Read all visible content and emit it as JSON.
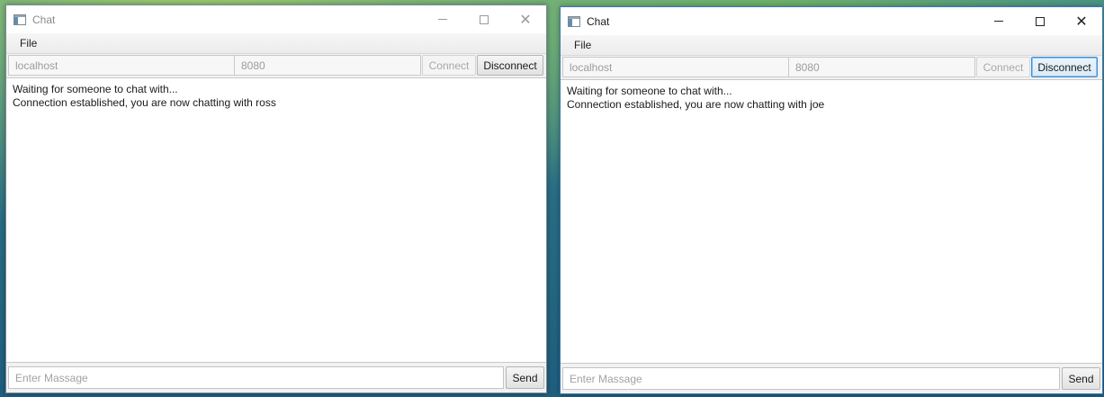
{
  "windows": [
    {
      "title": "Chat",
      "active": false,
      "menu": [
        "File"
      ],
      "host": "localhost",
      "port": "8080",
      "connect_label": "Connect",
      "disconnect_label": "Disconnect",
      "messages": [
        "Waiting for someone to chat with...",
        "Connection established, you are now chatting with ross"
      ],
      "message_placeholder": "Enter Massage",
      "send_label": "Send"
    },
    {
      "title": "Chat",
      "active": true,
      "menu": [
        "File"
      ],
      "host": "localhost",
      "port": "8080",
      "connect_label": "Connect",
      "disconnect_label": "Disconnect",
      "messages": [
        "Waiting for someone to chat with...",
        "Connection established, you are now chatting with joe"
      ],
      "message_placeholder": "Enter Massage",
      "send_label": "Send"
    }
  ],
  "icons": {
    "app": "app-window-icon",
    "minimize": "minimize-icon",
    "maximize": "maximize-icon",
    "close": "close-icon"
  },
  "colors": {
    "focus_border": "#3f8fd2",
    "disabled_text": "#a8a8a8"
  }
}
